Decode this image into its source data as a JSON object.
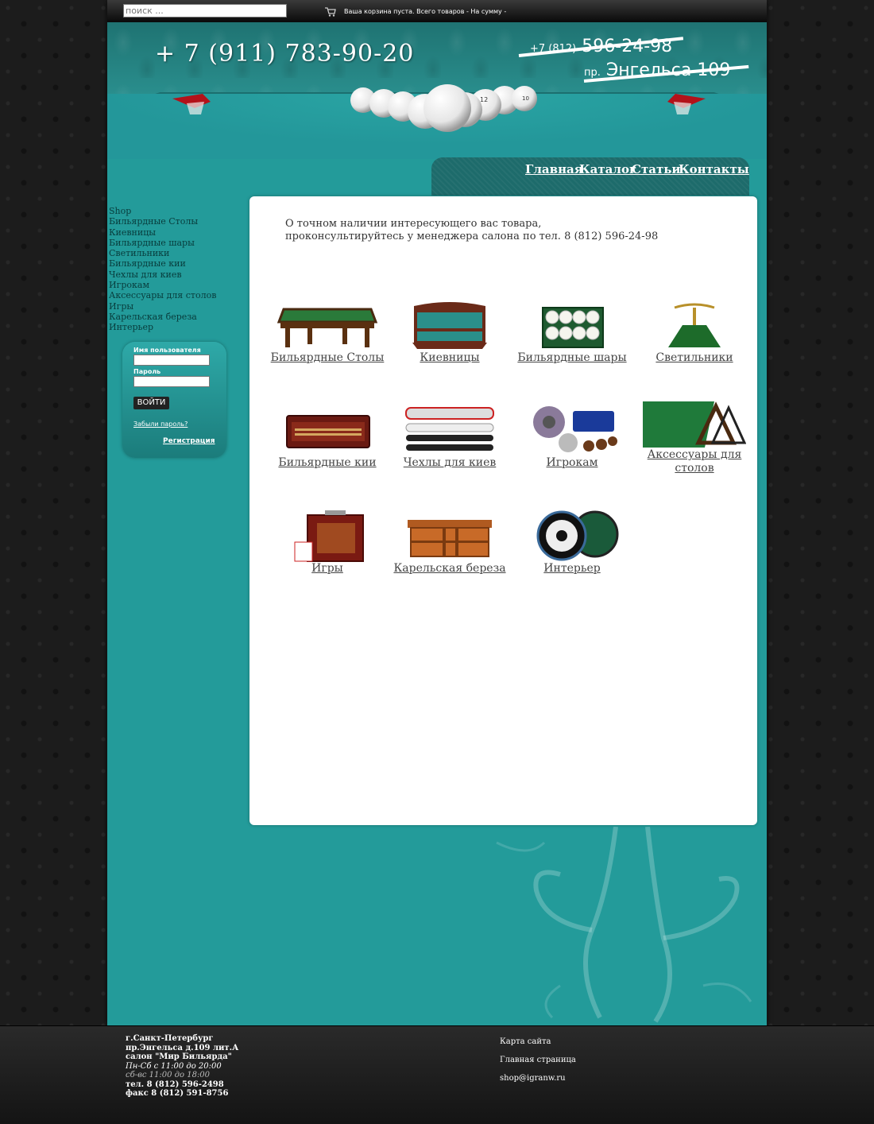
{
  "topbar": {
    "search_placeholder": "поиск ...",
    "cart_text": "Ваша корзина пуста. Всего товаров - На сумму -"
  },
  "header": {
    "phone_main": "+ 7 (911) 783-90-20",
    "phone_old_prefix": "+7 (812)",
    "phone_old_number": "596-24-98",
    "addr_old_prefix": "пр.",
    "addr_old_street": "Энгельса 109"
  },
  "nav": {
    "items": [
      "Главная",
      "Каталог",
      "Статьи",
      "Контакты"
    ]
  },
  "sidebar": {
    "menu": [
      "Shop",
      "Бильярдные Столы",
      "Киевницы",
      "Бильярдные шары",
      "Светильники",
      "Бильярдные кии",
      "Чехлы для киев",
      "Игрокам",
      "Аксессуары для столов",
      "Игры",
      "Карельская береза",
      "Интерьер"
    ]
  },
  "login": {
    "username_label": "Имя пользователя",
    "password_label": "Пароль",
    "button": "ВОЙТИ",
    "forgot": "Забыли пароль?",
    "register": "Регистрация"
  },
  "content": {
    "notice_line1": "О точном наличии интересующего вас товара,",
    "notice_line2": "проконсультируйтесь у менеджера салона по тел. 8 (812) 596-24-98",
    "categories": [
      {
        "name": "Бильярдные Столы",
        "icon": "billiard-table-icon"
      },
      {
        "name": "Киевницы",
        "icon": "cue-rack-icon"
      },
      {
        "name": "Бильярдные шары",
        "icon": "balls-box-icon"
      },
      {
        "name": "Светильники",
        "icon": "lamp-icon"
      },
      {
        "name": "Бильярдные кии",
        "icon": "cue-case-icon"
      },
      {
        "name": "Чехлы для киев",
        "icon": "cue-cover-icon"
      },
      {
        "name": "Игрокам",
        "icon": "chalk-holder-icon"
      },
      {
        "name": "Аксессуары для столов",
        "icon": "triangle-icon"
      },
      {
        "name": "Игры",
        "icon": "game-box-icon"
      },
      {
        "name": "Карельская береза",
        "icon": "wood-cabinet-icon"
      },
      {
        "name": "Интерьер",
        "icon": "clock-icon"
      }
    ]
  },
  "footer": {
    "city": "г.Санкт-Петербург",
    "address": "пр.Энгельса д.109 лит.А",
    "salon": "салон \"Мир Бильярда\"",
    "hours_weekdays": "Пн-Сб с 11:00 до 20:00",
    "hours_sunday": "сб-вс 11:00 до 18:00",
    "phone": "тел.  8 (812) 596-2498",
    "fax": "факс 8 (812) 591-8756",
    "links": [
      "Карта сайта",
      "Главная страница",
      "shop@igranw.ru"
    ]
  },
  "colors": {
    "page_teal": "#239b9a",
    "nav_dark_teal": "#1d6b6b",
    "background_dark": "#1c1c1c"
  }
}
